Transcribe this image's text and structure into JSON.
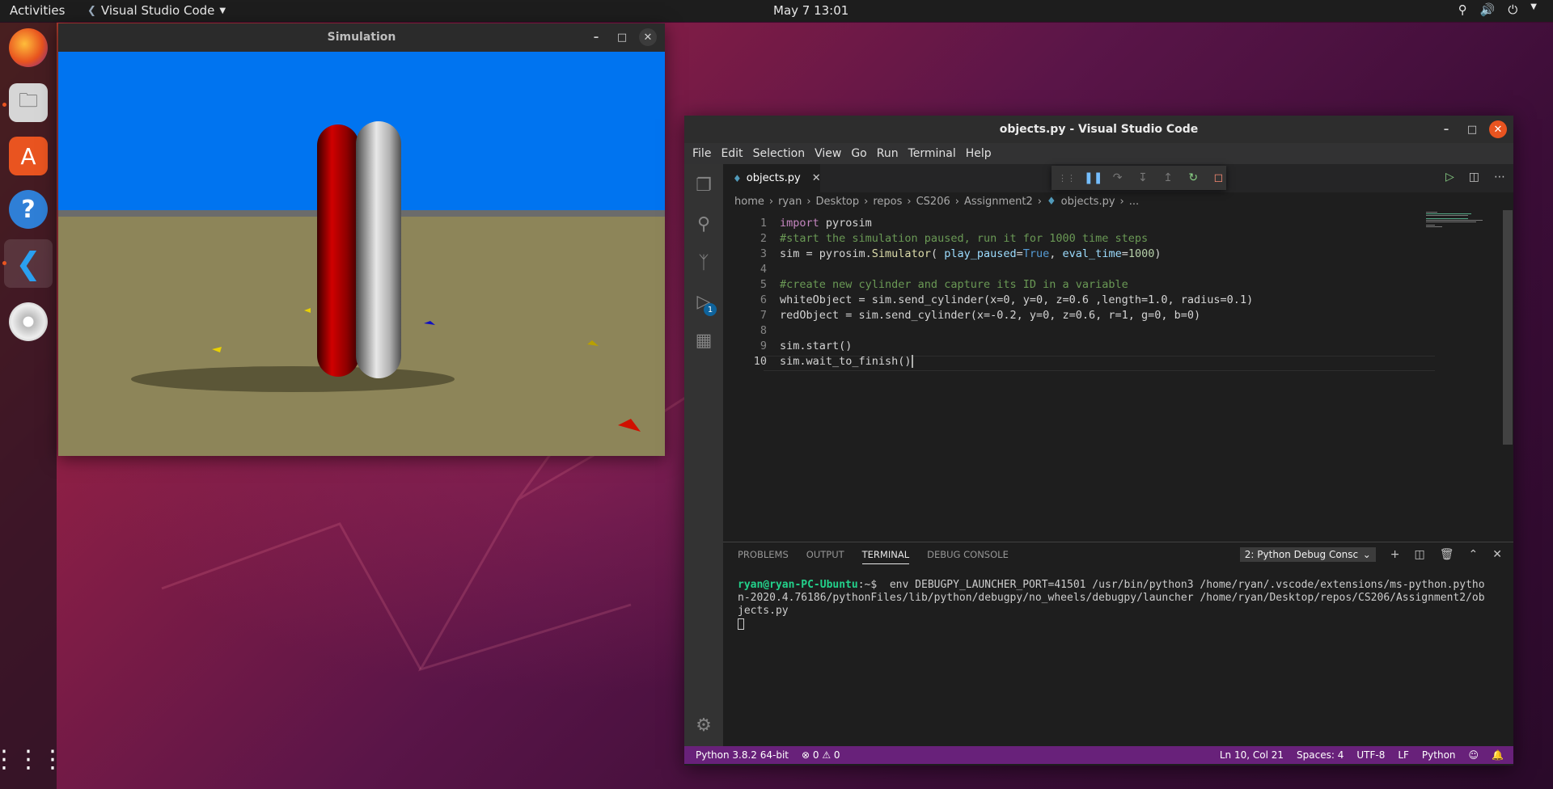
{
  "topbar": {
    "activities": "Activities",
    "app_name": "Visual Studio Code",
    "clock": "May 7  13:01"
  },
  "dock": {
    "items": [
      "firefox-icon",
      "files-icon",
      "software-icon",
      "help-icon",
      "vscode-icon",
      "disc-icon",
      "app-grid-icon"
    ]
  },
  "simulation": {
    "title": "Simulation",
    "colors": {
      "sky": "#0074f0",
      "ground": "#8d8559",
      "horizon": "#6b6b6b",
      "red_cylinder": "#c00000",
      "white_cylinder": "#d0d0d0"
    }
  },
  "vscode": {
    "title": "objects.py - Visual Studio Code",
    "menu": [
      "File",
      "Edit",
      "Selection",
      "View",
      "Go",
      "Run",
      "Terminal",
      "Help"
    ],
    "tab": {
      "label": "objects.py"
    },
    "breadcrumb": [
      "home",
      "ryan",
      "Desktop",
      "repos",
      "CS206",
      "Assignment2",
      "objects.py",
      "..."
    ],
    "activity_badge": "1",
    "code_lines": [
      {
        "n": "1"
      },
      {
        "n": "2"
      },
      {
        "n": "3"
      },
      {
        "n": "4"
      },
      {
        "n": "5"
      },
      {
        "n": "6"
      },
      {
        "n": "7"
      },
      {
        "n": "8"
      },
      {
        "n": "9"
      },
      {
        "n": "10"
      }
    ],
    "code": {
      "l1_kw": "import",
      "l1_rest": " pyrosim",
      "l2": "#start the simulation paused, run it for 1000 time steps",
      "l3_a": "sim = pyrosim.",
      "l3_fn": "Simulator",
      "l3_b": "( ",
      "l3_p1": "play_paused",
      "l3_c": "=",
      "l3_v1": "True",
      "l3_d": ", ",
      "l3_p2": "eval_time",
      "l3_e": "=",
      "l3_v2": "1000",
      "l3_f": ")",
      "l5": "#create new cylinder and capture its ID in a variable",
      "l6": "whiteObject = sim.send_cylinder(x=0, y=0, z=0.6 ,length=1.0, radius=0.1)",
      "l7": "redObject = sim.send_cylinder(x=-0.2, y=0, z=0.6, r=1, g=0, b=0)",
      "l9": "sim.start()",
      "l10": "sim.wait_to_finish()"
    },
    "panel": {
      "tabs": [
        "PROBLEMS",
        "OUTPUT",
        "TERMINAL",
        "DEBUG CONSOLE"
      ],
      "terminal_select": "2: Python Debug Consc",
      "prompt": "ryan@ryan-PC-Ubuntu",
      "prompt_suffix": ":~$",
      "command": "  env DEBUGPY_LAUNCHER_PORT=41501 /usr/bin/python3 /home/ryan/.vscode/extensions/ms-python.python-2020.4.76186/pythonFiles/lib/python/debugpy/no_wheels/debugpy/launcher /home/ryan/Desktop/repos/CS206/Assignment2/objects.py"
    },
    "status": {
      "python": "Python 3.8.2 64-bit",
      "problems": "⊗ 0 ⚠ 0",
      "position": "Ln 10, Col 21",
      "spaces": "Spaces: 4",
      "encoding": "UTF-8",
      "eol": "LF",
      "language": "Python"
    },
    "colors": {
      "statusbar": "#68217a",
      "accent": "#0e639c"
    }
  }
}
